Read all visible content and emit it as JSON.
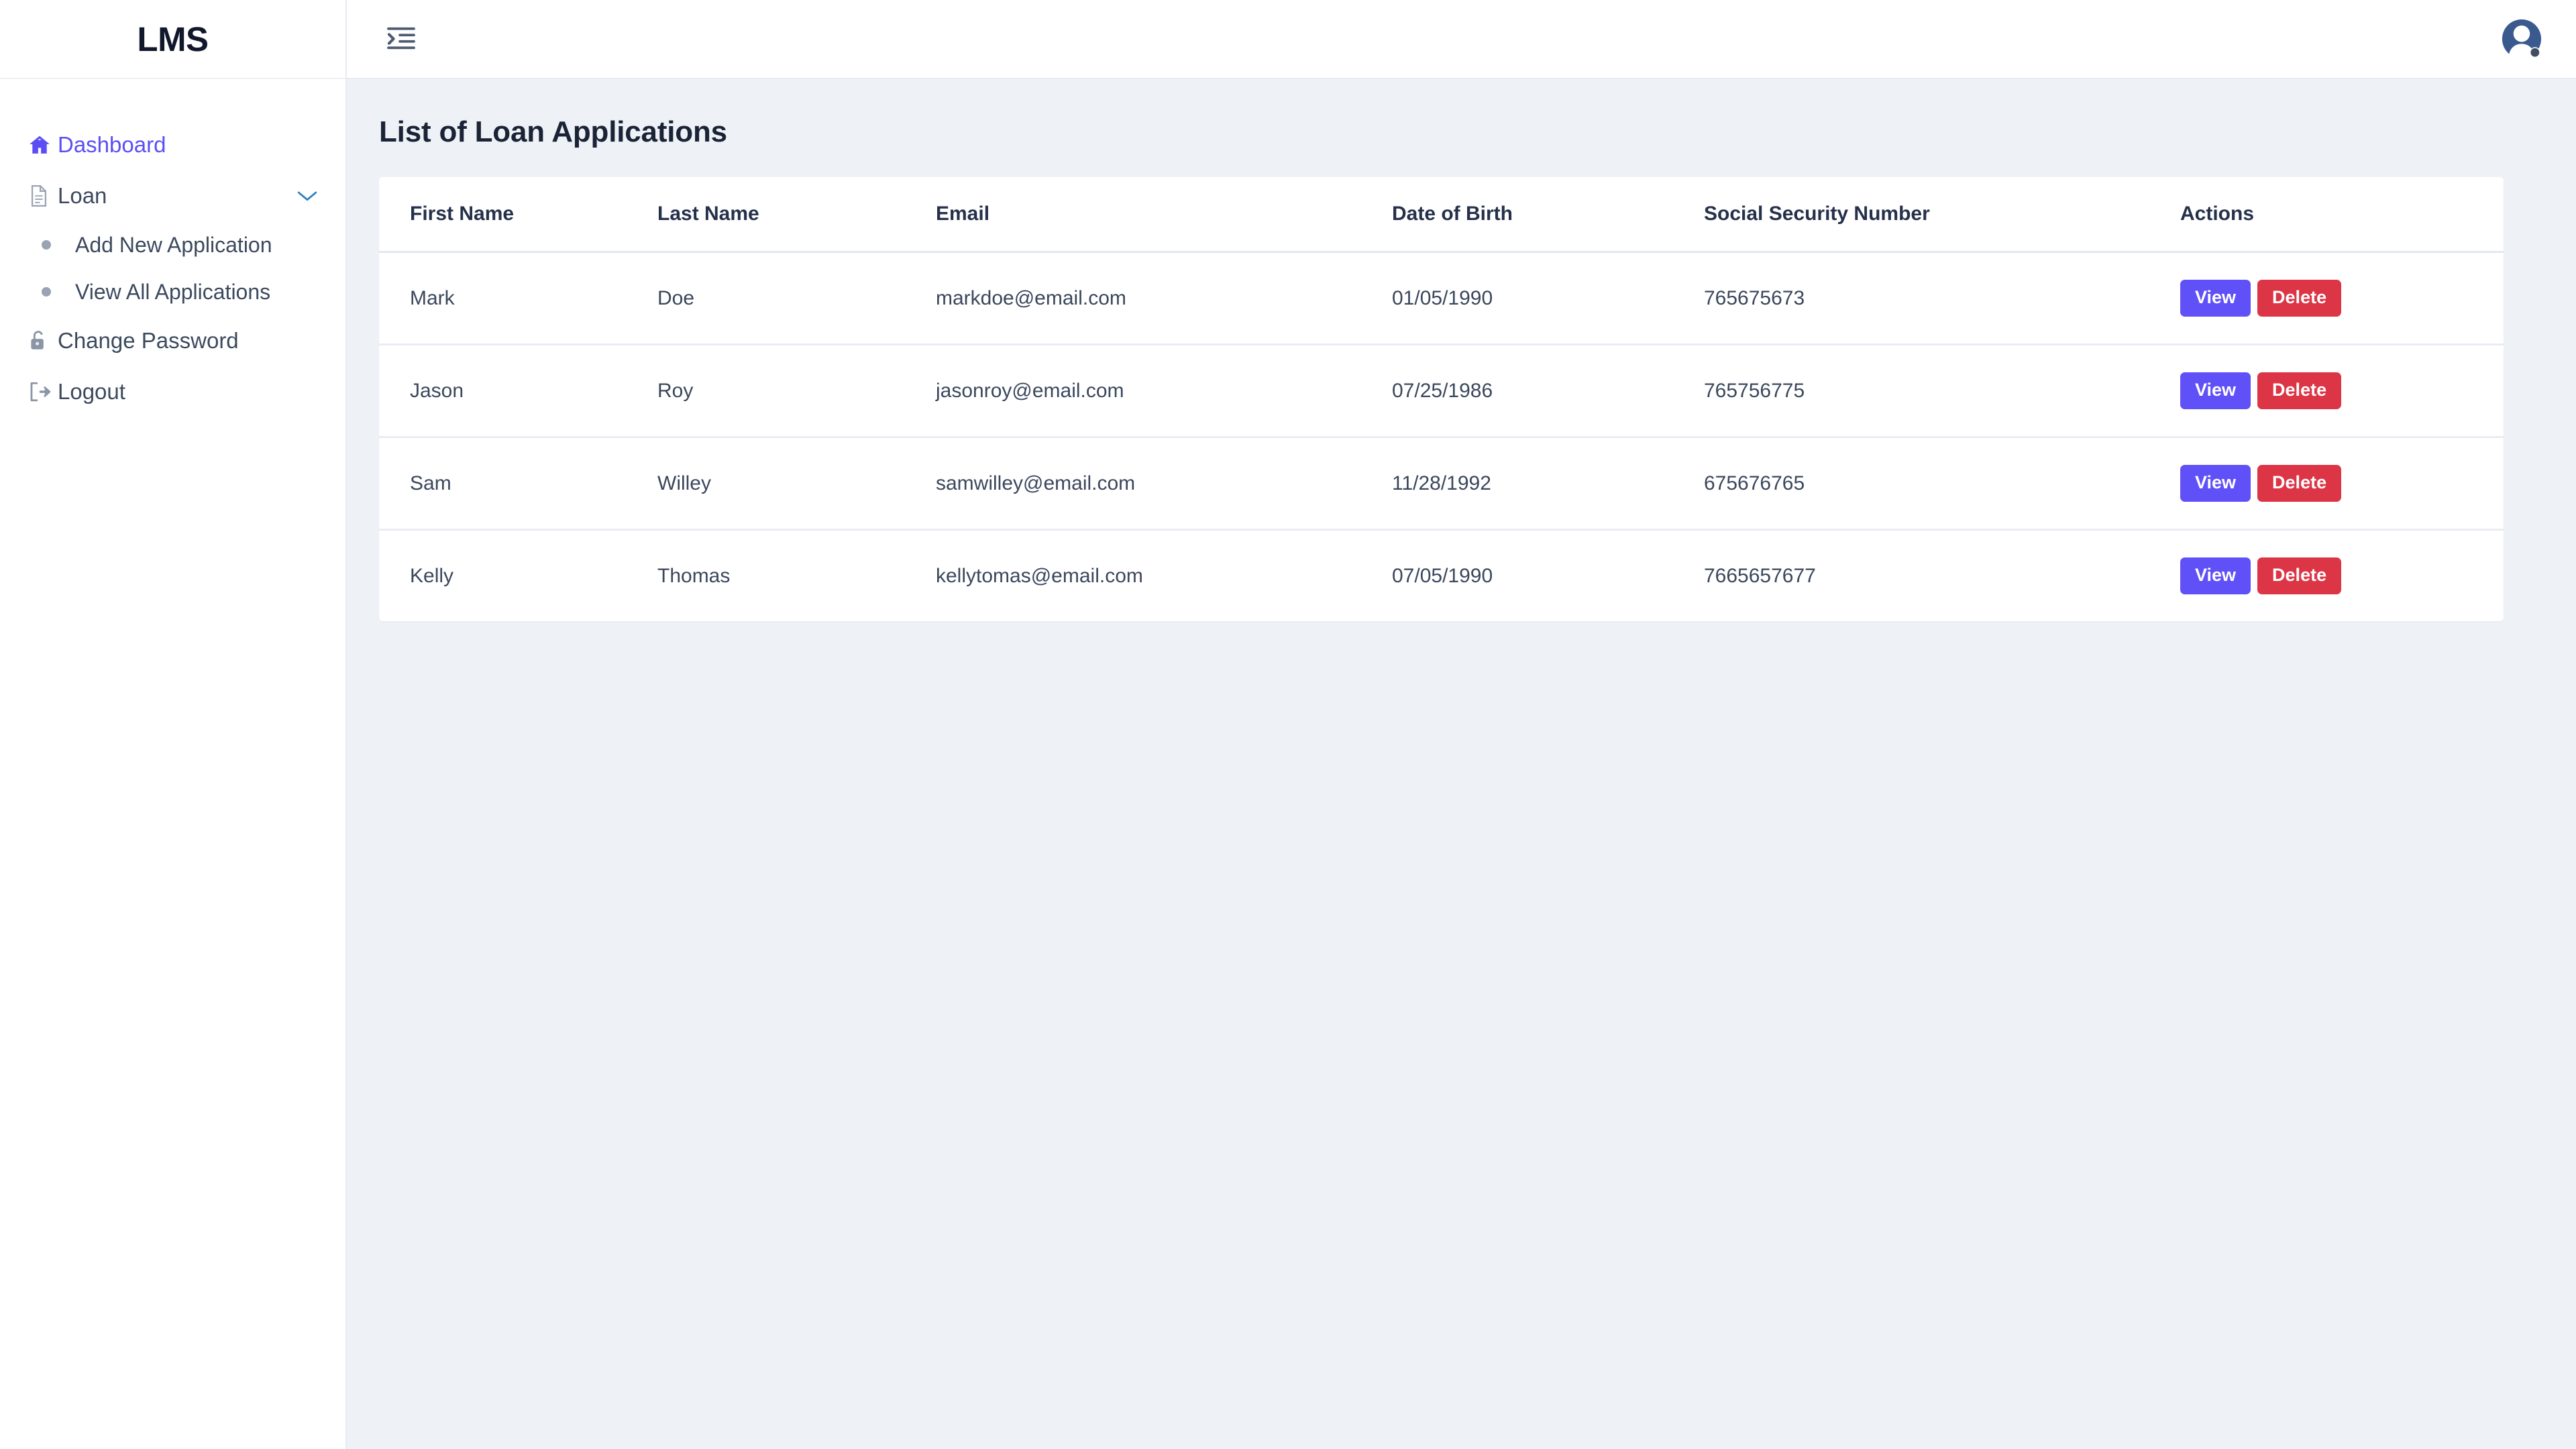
{
  "brand": {
    "name": "LMS"
  },
  "colors": {
    "accent_purple": "#5b4ef5",
    "view_button": "#6050f7",
    "delete_button": "#dc3545",
    "page_background": "#eef1f6",
    "sidebar_background": "#ffffff",
    "text_primary": "#1b2437",
    "text_secondary": "#3b475c"
  },
  "sidebar": {
    "items": [
      {
        "label": "Dashboard",
        "icon": "home-icon",
        "active": true
      },
      {
        "label": "Loan",
        "icon": "document-icon",
        "active": false,
        "expanded": true,
        "chevron": "chevron-down-icon"
      },
      {
        "label": "Change Password",
        "icon": "unlock-icon",
        "active": false
      },
      {
        "label": "Logout",
        "icon": "sign-out-icon",
        "active": false
      }
    ],
    "loan_submenu": [
      {
        "label": "Add New Application"
      },
      {
        "label": "View All Applications"
      }
    ]
  },
  "topbar": {
    "toggle_icon": "menu-indent-icon",
    "avatar_icon": "user-avatar-icon"
  },
  "main": {
    "page_title": "List of Loan Applications",
    "table": {
      "columns": [
        "First Name",
        "Last Name",
        "Email",
        "Date of Birth",
        "Social Security Number",
        "Actions"
      ],
      "row_actions": {
        "view_label": "View",
        "delete_label": "Delete"
      },
      "rows": [
        {
          "first_name": "Mark",
          "last_name": "Doe",
          "email": "markdoe@email.com",
          "dob": "01/05/1990",
          "ssn": "765675673"
        },
        {
          "first_name": "Jason",
          "last_name": "Roy",
          "email": "jasonroy@email.com",
          "dob": "07/25/1986",
          "ssn": "765756775"
        },
        {
          "first_name": "Sam",
          "last_name": "Willey",
          "email": "samwilley@email.com",
          "dob": "11/28/1992",
          "ssn": "675676765"
        },
        {
          "first_name": "Kelly",
          "last_name": "Thomas",
          "email": "kellytomas@email.com",
          "dob": "07/05/1990",
          "ssn": "7665657677"
        }
      ]
    }
  }
}
